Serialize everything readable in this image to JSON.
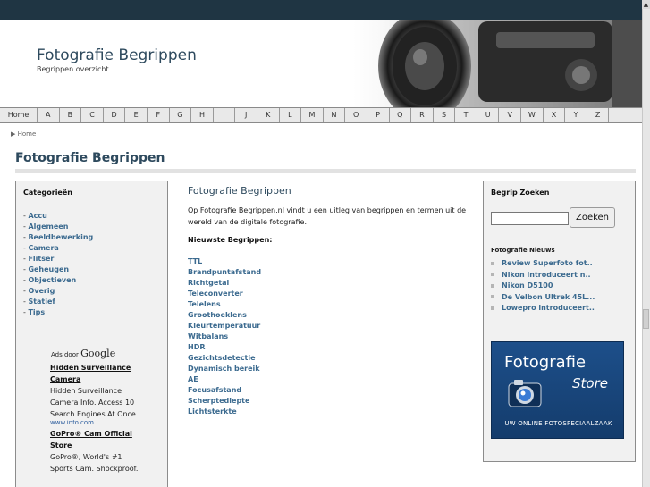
{
  "header": {
    "site_title": "Fotografie Begrippen",
    "site_subtitle": "Begrippen overzicht"
  },
  "alphabet_nav": {
    "home": "Home",
    "letters": [
      "A",
      "B",
      "C",
      "D",
      "E",
      "F",
      "G",
      "H",
      "I",
      "J",
      "K",
      "L",
      "M",
      "N",
      "O",
      "P",
      "Q",
      "R",
      "S",
      "T",
      "U",
      "V",
      "W",
      "X",
      "Y",
      "Z"
    ]
  },
  "breadcrumb": {
    "home": "Home"
  },
  "page": {
    "title": "Fotografie Begrippen"
  },
  "left": {
    "heading": "Categorieën",
    "categories": [
      "Accu",
      "Algemeen",
      "Beeldbewerking",
      "Camera",
      "Flitser",
      "Geheugen",
      "Objectieven",
      "Overig",
      "Statief",
      "Tips"
    ],
    "ads": {
      "by_label": "Ads door",
      "google": "Google",
      "items": [
        {
          "title": "Hidden Surveillance Camera",
          "text": "Hidden Surveillance Camera Info. Access 10 Search Engines At Once.",
          "url": "www.info.com"
        },
        {
          "title": "GoPro® Cam Official Store",
          "text": "GoPro®, World's #1 Sports Cam. Shockproof."
        }
      ]
    }
  },
  "center": {
    "title": "Fotografie Begrippen",
    "intro": "Op Fotografie Begrippen.nl vindt u een uitleg van begrippen en termen uit de wereld van de digitale fotografie.",
    "newest_heading": "Nieuwste Begrippen:",
    "terms": [
      "TTL",
      "Brandpuntafstand",
      "Richtgetal",
      "Teleconverter",
      "Telelens",
      "Groothoeklens",
      "Kleurtemperatuur",
      "Witbalans",
      "HDR",
      "Gezichtsdetectie",
      "Dynamisch bereik",
      "AE",
      "Focusafstand",
      "Scherptediepte",
      "Lichtsterkte"
    ]
  },
  "right": {
    "search_heading": "Begrip Zoeken",
    "search_value": "",
    "search_button": "Zoeken",
    "news_heading": "Fotografie Nieuws",
    "news": [
      "Review Superfoto fot..",
      "Nikon introduceert n..",
      "Nikon D5100",
      "De Velbon Ultrek 45L...",
      "Lowepro introduceert.."
    ],
    "store": {
      "title": "Fotografie",
      "word": "Store",
      "tagline": "UW ONLINE FOTOSPECIAALZAAK"
    }
  },
  "colors": {
    "topbar": "#1f3543",
    "title_blue": "#2e4a5e",
    "link_blue": "#3b6a8f",
    "store_blue": "#1d4f8a"
  }
}
